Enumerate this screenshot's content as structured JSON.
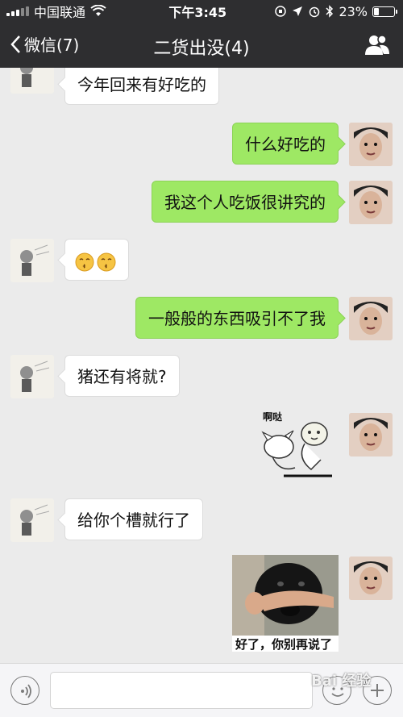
{
  "status_bar": {
    "carrier": "中国联通",
    "time": "下午3:45",
    "battery": "23%",
    "battery_level": 0.23
  },
  "nav": {
    "back_label": "微信(7)",
    "title": "二货出没(4)"
  },
  "messages": [
    {
      "side": "left",
      "text": "今年回来有好吃的"
    },
    {
      "side": "right",
      "text": "什么好吃的"
    },
    {
      "side": "right",
      "text": "我这个人吃饭很讲究的"
    },
    {
      "side": "left",
      "text": ""
    },
    {
      "side": "right",
      "text": "一般般的东西吸引不了我"
    },
    {
      "side": "left",
      "text": "猪还有将就?"
    },
    {
      "side": "right",
      "sticker_text": "啊哒"
    },
    {
      "side": "left",
      "text": "给你个槽就行了"
    },
    {
      "side": "right",
      "sticker_caption": "好了，你别再说了"
    }
  ],
  "input": {
    "value": "",
    "placeholder": ""
  },
  "watermark": "Bai 经验",
  "colors": {
    "header_bg": "#2e2e30",
    "chat_bg": "#ebebeb",
    "bubble_green": "#9ee864",
    "bubble_white": "#ffffff"
  },
  "icons": [
    "back-chevron-icon",
    "contacts-icon",
    "wifi-icon",
    "voice-icon",
    "emoji-face-icon",
    "plus-icon"
  ]
}
